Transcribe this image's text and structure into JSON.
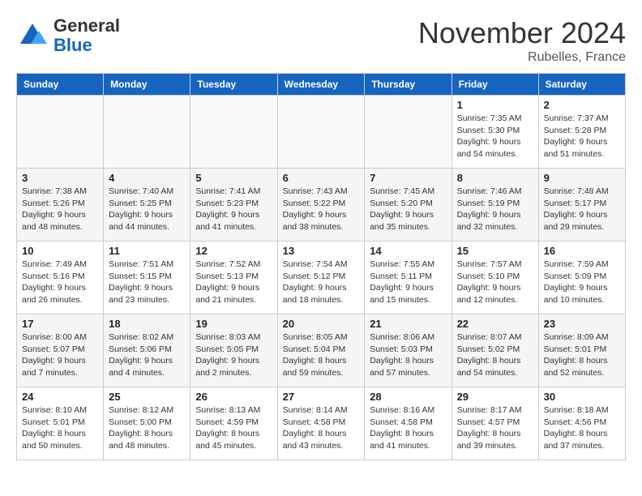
{
  "header": {
    "logo_general": "General",
    "logo_blue": "Blue",
    "month_title": "November 2024",
    "location": "Rubelles, France"
  },
  "days_of_week": [
    "Sunday",
    "Monday",
    "Tuesday",
    "Wednesday",
    "Thursday",
    "Friday",
    "Saturday"
  ],
  "weeks": [
    [
      {
        "day": "",
        "info": ""
      },
      {
        "day": "",
        "info": ""
      },
      {
        "day": "",
        "info": ""
      },
      {
        "day": "",
        "info": ""
      },
      {
        "day": "",
        "info": ""
      },
      {
        "day": "1",
        "info": "Sunrise: 7:35 AM\nSunset: 5:30 PM\nDaylight: 9 hours and 54 minutes."
      },
      {
        "day": "2",
        "info": "Sunrise: 7:37 AM\nSunset: 5:28 PM\nDaylight: 9 hours and 51 minutes."
      }
    ],
    [
      {
        "day": "3",
        "info": "Sunrise: 7:38 AM\nSunset: 5:26 PM\nDaylight: 9 hours and 48 minutes."
      },
      {
        "day": "4",
        "info": "Sunrise: 7:40 AM\nSunset: 5:25 PM\nDaylight: 9 hours and 44 minutes."
      },
      {
        "day": "5",
        "info": "Sunrise: 7:41 AM\nSunset: 5:23 PM\nDaylight: 9 hours and 41 minutes."
      },
      {
        "day": "6",
        "info": "Sunrise: 7:43 AM\nSunset: 5:22 PM\nDaylight: 9 hours and 38 minutes."
      },
      {
        "day": "7",
        "info": "Sunrise: 7:45 AM\nSunset: 5:20 PM\nDaylight: 9 hours and 35 minutes."
      },
      {
        "day": "8",
        "info": "Sunrise: 7:46 AM\nSunset: 5:19 PM\nDaylight: 9 hours and 32 minutes."
      },
      {
        "day": "9",
        "info": "Sunrise: 7:48 AM\nSunset: 5:17 PM\nDaylight: 9 hours and 29 minutes."
      }
    ],
    [
      {
        "day": "10",
        "info": "Sunrise: 7:49 AM\nSunset: 5:16 PM\nDaylight: 9 hours and 26 minutes."
      },
      {
        "day": "11",
        "info": "Sunrise: 7:51 AM\nSunset: 5:15 PM\nDaylight: 9 hours and 23 minutes."
      },
      {
        "day": "12",
        "info": "Sunrise: 7:52 AM\nSunset: 5:13 PM\nDaylight: 9 hours and 21 minutes."
      },
      {
        "day": "13",
        "info": "Sunrise: 7:54 AM\nSunset: 5:12 PM\nDaylight: 9 hours and 18 minutes."
      },
      {
        "day": "14",
        "info": "Sunrise: 7:55 AM\nSunset: 5:11 PM\nDaylight: 9 hours and 15 minutes."
      },
      {
        "day": "15",
        "info": "Sunrise: 7:57 AM\nSunset: 5:10 PM\nDaylight: 9 hours and 12 minutes."
      },
      {
        "day": "16",
        "info": "Sunrise: 7:59 AM\nSunset: 5:09 PM\nDaylight: 9 hours and 10 minutes."
      }
    ],
    [
      {
        "day": "17",
        "info": "Sunrise: 8:00 AM\nSunset: 5:07 PM\nDaylight: 9 hours and 7 minutes."
      },
      {
        "day": "18",
        "info": "Sunrise: 8:02 AM\nSunset: 5:06 PM\nDaylight: 9 hours and 4 minutes."
      },
      {
        "day": "19",
        "info": "Sunrise: 8:03 AM\nSunset: 5:05 PM\nDaylight: 9 hours and 2 minutes."
      },
      {
        "day": "20",
        "info": "Sunrise: 8:05 AM\nSunset: 5:04 PM\nDaylight: 8 hours and 59 minutes."
      },
      {
        "day": "21",
        "info": "Sunrise: 8:06 AM\nSunset: 5:03 PM\nDaylight: 8 hours and 57 minutes."
      },
      {
        "day": "22",
        "info": "Sunrise: 8:07 AM\nSunset: 5:02 PM\nDaylight: 8 hours and 54 minutes."
      },
      {
        "day": "23",
        "info": "Sunrise: 8:09 AM\nSunset: 5:01 PM\nDaylight: 8 hours and 52 minutes."
      }
    ],
    [
      {
        "day": "24",
        "info": "Sunrise: 8:10 AM\nSunset: 5:01 PM\nDaylight: 8 hours and 50 minutes."
      },
      {
        "day": "25",
        "info": "Sunrise: 8:12 AM\nSunset: 5:00 PM\nDaylight: 8 hours and 48 minutes."
      },
      {
        "day": "26",
        "info": "Sunrise: 8:13 AM\nSunset: 4:59 PM\nDaylight: 8 hours and 45 minutes."
      },
      {
        "day": "27",
        "info": "Sunrise: 8:14 AM\nSunset: 4:58 PM\nDaylight: 8 hours and 43 minutes."
      },
      {
        "day": "28",
        "info": "Sunrise: 8:16 AM\nSunset: 4:58 PM\nDaylight: 8 hours and 41 minutes."
      },
      {
        "day": "29",
        "info": "Sunrise: 8:17 AM\nSunset: 4:57 PM\nDaylight: 8 hours and 39 minutes."
      },
      {
        "day": "30",
        "info": "Sunrise: 8:18 AM\nSunset: 4:56 PM\nDaylight: 8 hours and 37 minutes."
      }
    ]
  ]
}
